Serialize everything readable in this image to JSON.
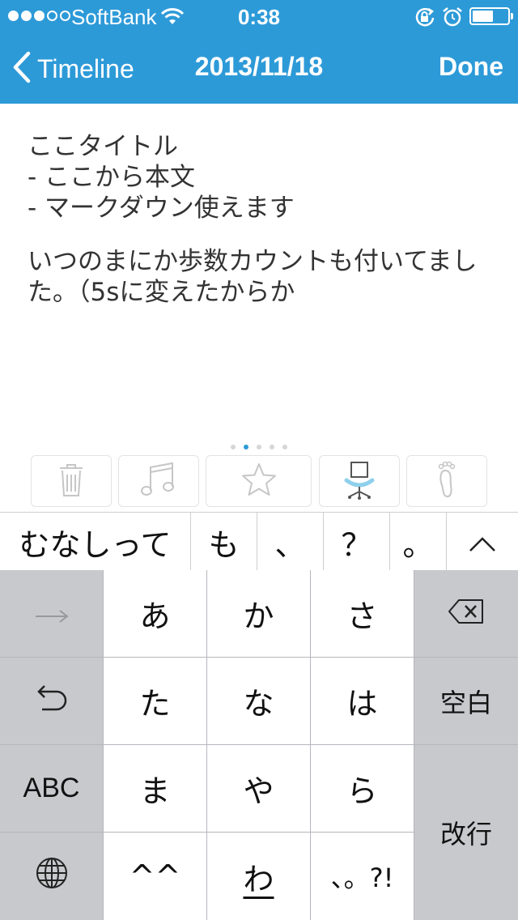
{
  "status_bar": {
    "carrier": "SoftBank",
    "time": "0:38",
    "signal_bars": 3,
    "signal_total": 5,
    "battery_level": 0.6
  },
  "nav": {
    "back_label": "Timeline",
    "title": "2013/11/18",
    "done_label": "Done"
  },
  "editor": {
    "lines": [
      "ここタイトル",
      "- ここから本文",
      "- マークダウン使えます"
    ],
    "paragraph": "いつのまにか歩数カウントも付いてました。（5sに変えたからか"
  },
  "page_indicator": {
    "count": 5,
    "active_index": 1
  },
  "toolbar": {
    "icons": [
      "trash-icon",
      "music-icon",
      "star-icon",
      "chair-icon",
      "footprint-icon"
    ]
  },
  "candidates": [
    "むなしって",
    "も",
    "、",
    "？",
    "。"
  ],
  "keyboard": {
    "row1": [
      "→",
      "あ",
      "か",
      "さ"
    ],
    "row2": [
      "た",
      "な",
      "は",
      "空白"
    ],
    "row3": [
      "ABC",
      "ま",
      "や",
      "ら",
      "改行"
    ],
    "row4": [
      "^^",
      "わ",
      "、。?!"
    ]
  },
  "colors": {
    "accent": "#2d9ad8",
    "keyboard_bg": "#b5b7bd",
    "key_gray": "#c7c9cd",
    "icon_gray": "#c6c6c6"
  }
}
